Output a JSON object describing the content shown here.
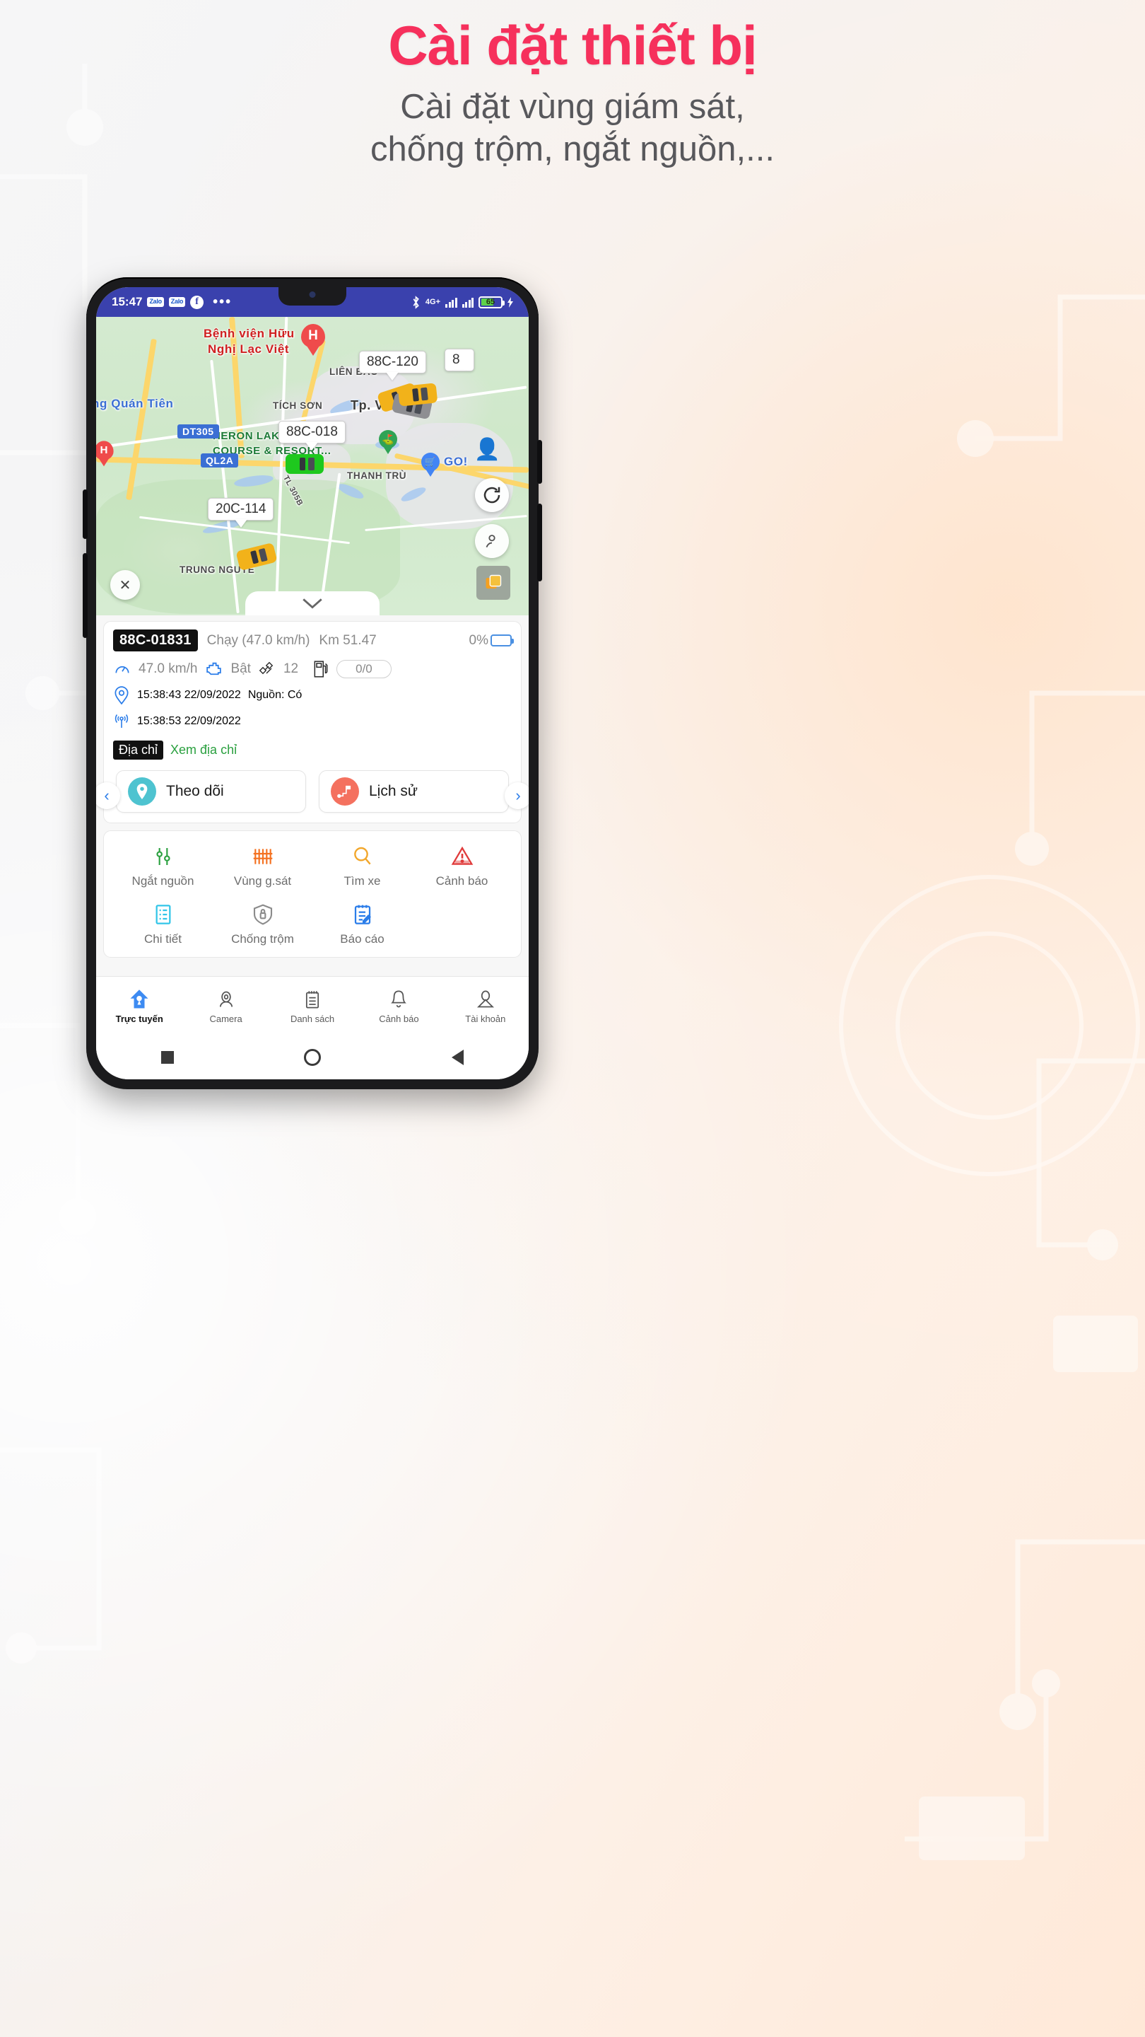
{
  "headline": {
    "title": "Cài đặt thiết bị",
    "subtitle_line1": "Cài đặt vùng giám sát,",
    "subtitle_line2": "chống trộm, ngắt nguồn,...",
    "title_color": "#f6305c",
    "subtitle_color": "#58585c"
  },
  "statusbar": {
    "time": "15:47",
    "app_badge_1": "Zalo",
    "app_badge_2": "Zalo",
    "facebook_icon": "f",
    "overflow": "•••",
    "network": "4G+",
    "battery_percent": "65",
    "bluetooth_icon": "bluetooth-icon",
    "background": "#3a41ad"
  },
  "map": {
    "labels": [
      {
        "text": "Bệnh viện Hữu",
        "style": "red"
      },
      {
        "text": "Nghị Lạc Việt",
        "style": "red"
      },
      {
        "text": "ng Quán Tiên",
        "style": "blue"
      },
      {
        "text": "TÍCH SƠN",
        "style": "dark"
      },
      {
        "text": "LIÊN BẢO",
        "style": "dark"
      },
      {
        "text": "Tp. Vĩnh",
        "style": "darkbig"
      },
      {
        "text": "HERON LAKE GOLF",
        "style": "green"
      },
      {
        "text": "COURSE & RESORT...",
        "style": "green"
      },
      {
        "text": "THANH TRÙ",
        "style": "dark"
      },
      {
        "text": "TRUNG NGUYÊ",
        "style": "dark"
      },
      {
        "text": "TL 305B",
        "style": "dark"
      },
      {
        "text": "GO!",
        "style": "blue"
      }
    ],
    "road_shields": [
      "DT305",
      "QL2A"
    ],
    "hospital_pin": "H",
    "vehicle_plates": [
      "88C-120",
      "88C-018",
      "20C-114"
    ],
    "partial_plate_right": "8",
    "close_button": "✕",
    "collapse_chevron": "∨",
    "refresh_icon": "refresh-icon",
    "account_icon": "account-pin-icon",
    "layers_icon": "layers-icon"
  },
  "device_card": {
    "plate": "88C-01831",
    "status": "Chạy (47.0 km/h)",
    "odometer": "Km 51.47",
    "battery": "0%",
    "speed": "47.0 km/h",
    "engine_label": "Bật",
    "satellites": "12",
    "fuel": "0/0",
    "gps_time": "15:38:43 22/09/2022",
    "power_source": "Nguồn: Có",
    "signal_time": "15:38:53 22/09/2022",
    "address_badge": "Địa chỉ",
    "address_link": "Xem địa chỉ",
    "track_button": "Theo dõi",
    "history_button": "Lịch sử",
    "track_color": "#4ec3d0",
    "history_color": "#f4715f",
    "prev_arrow": "‹",
    "next_arrow": "›"
  },
  "actions": [
    {
      "label": "Ngắt nguồn",
      "icon": "power-cut-icon",
      "color": "#2aa03f"
    },
    {
      "label": "Vùng g.sát",
      "icon": "geofence-icon",
      "color": "#f4701f"
    },
    {
      "label": "Tìm xe",
      "icon": "search-icon",
      "color": "#f2a72c"
    },
    {
      "label": "Cảnh báo",
      "icon": "warning-icon",
      "color": "#e03b3b"
    },
    {
      "label": "Chi tiết",
      "icon": "details-list-icon",
      "color": "#32c5e8"
    },
    {
      "label": "Chống trộm",
      "icon": "shield-lock-icon",
      "color": "#8b8b8b"
    },
    {
      "label": "Báo cáo",
      "icon": "report-icon",
      "color": "#2b7de9"
    }
  ],
  "bottom_nav": [
    {
      "label": "Trực tuyến",
      "icon": "home-pin-icon",
      "active": true
    },
    {
      "label": "Camera",
      "icon": "camera-icon",
      "active": false
    },
    {
      "label": "Danh sách",
      "icon": "list-icon",
      "active": false
    },
    {
      "label": "Cảnh báo",
      "icon": "bell-icon",
      "active": false
    },
    {
      "label": "Tài khoản",
      "icon": "account-icon",
      "active": false
    }
  ],
  "android_nav": {
    "recents": "square-icon",
    "home": "circle-icon",
    "back": "triangle-back-icon"
  }
}
